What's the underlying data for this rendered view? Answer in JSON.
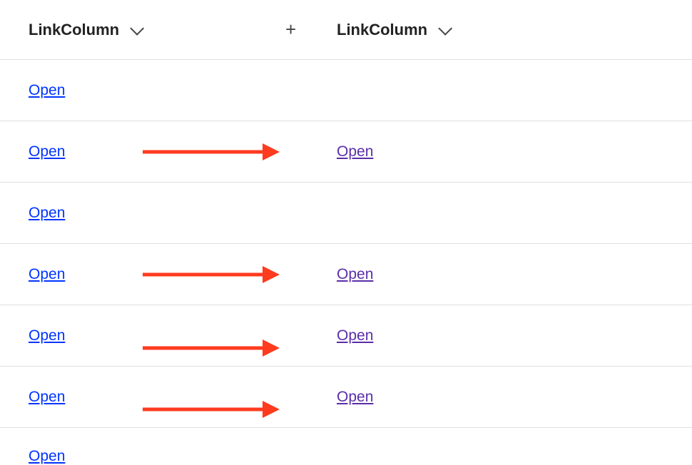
{
  "columns": {
    "col1": {
      "label": "LinkColumn"
    },
    "col2": {
      "label": "LinkColumn"
    },
    "add": {
      "glyph": "+"
    }
  },
  "rows": [
    {
      "col1": {
        "text": "Open",
        "color": "blue"
      },
      "col2": null,
      "arrow": null
    },
    {
      "col1": {
        "text": "Open",
        "color": "blue"
      },
      "col2": {
        "text": "Open",
        "color": "purple"
      },
      "arrow": "mid"
    },
    {
      "col1": {
        "text": "Open",
        "color": "blue"
      },
      "col2": null,
      "arrow": null
    },
    {
      "col1": {
        "text": "Open",
        "color": "blue"
      },
      "col2": {
        "text": "Open",
        "color": "purple"
      },
      "arrow": "mid"
    },
    {
      "col1": {
        "text": "Open",
        "color": "blue"
      },
      "col2": {
        "text": "Open",
        "color": "purple"
      },
      "arrow": "low"
    },
    {
      "col1": {
        "text": "Open",
        "color": "blue"
      },
      "col2": {
        "text": "Open",
        "color": "purple"
      },
      "arrow": "low"
    },
    {
      "col1": {
        "text": "Open",
        "color": "blue"
      },
      "col2": null,
      "arrow": null,
      "partial": true
    }
  ]
}
